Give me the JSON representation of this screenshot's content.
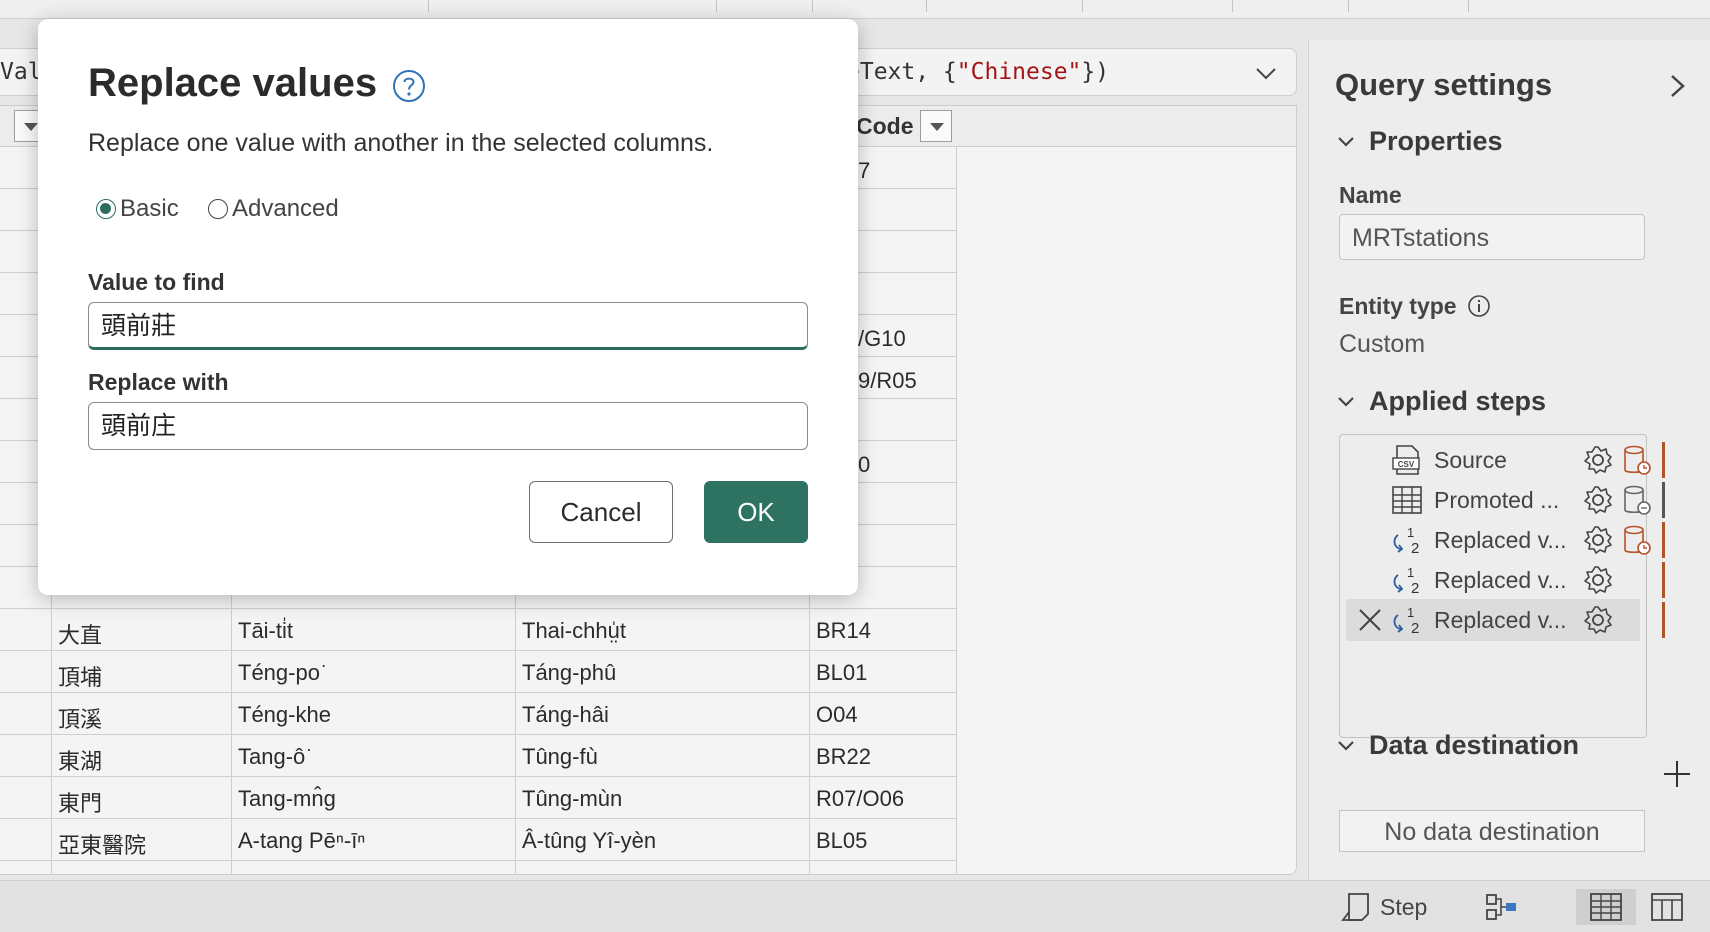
{
  "formula_bar": {
    "left_fragment": "Val",
    "right_fragment_prefix": "eText, {",
    "right_fragment_string": "\"Chinese\"",
    "right_fragment_suffix": "})"
  },
  "grid": {
    "visible_header_code": "Code",
    "partial_codes": [
      "7",
      "",
      "",
      "",
      "/G10",
      "9/R05",
      "",
      "0",
      "",
      "",
      ""
    ],
    "rows": [
      [
        "大直",
        "Tāi-ti̍t",
        "Thai-chhṳ̍t",
        "BR14"
      ],
      [
        "頂埔",
        "Téng-po͘",
        "Táng-phû",
        "BL01"
      ],
      [
        "頂溪",
        "Téng-khe",
        "Táng-hâi",
        "O04"
      ],
      [
        "東湖",
        "Tang-ô͘",
        "Tûng-fù",
        "BR22"
      ],
      [
        "東門",
        "Tang-mn̂g",
        "Tûng-mùn",
        "R07/O06"
      ],
      [
        "亞東醫院",
        "A-tang Pēⁿ-īⁿ",
        "Â-tûng Yî-yèn",
        "BL05"
      ]
    ]
  },
  "dialog": {
    "title": "Replace values",
    "description": "Replace one value with another in the selected columns.",
    "mode_options": [
      "Basic",
      "Advanced"
    ],
    "selected_mode": "Basic",
    "find_label": "Value to find",
    "find_value": "頭前莊",
    "replace_label": "Replace with",
    "replace_value": "頭前庄",
    "cancel_label": "Cancel",
    "ok_label": "OK"
  },
  "query_settings": {
    "title": "Query settings",
    "properties_label": "Properties",
    "name_label": "Name",
    "name_value": "MRTstations",
    "entity_type_label": "Entity type",
    "entity_type_value": "Custom",
    "applied_steps_label": "Applied steps",
    "steps": [
      {
        "name": "Source",
        "icon": "csv-icon"
      },
      {
        "name": "Promoted ...",
        "icon": "table-icon"
      },
      {
        "name": "Replaced v...",
        "icon": "replace-values-icon"
      },
      {
        "name": "Replaced v...",
        "icon": "replace-values-icon"
      },
      {
        "name": "Replaced v...",
        "icon": "replace-values-icon",
        "selected": true
      }
    ],
    "data_destination_label": "Data destination",
    "data_destination_value": "No data destination"
  },
  "status_bar": {
    "step_label": "Step"
  },
  "colors": {
    "accent": "#2e7361",
    "step_bar": "#b5532a"
  }
}
